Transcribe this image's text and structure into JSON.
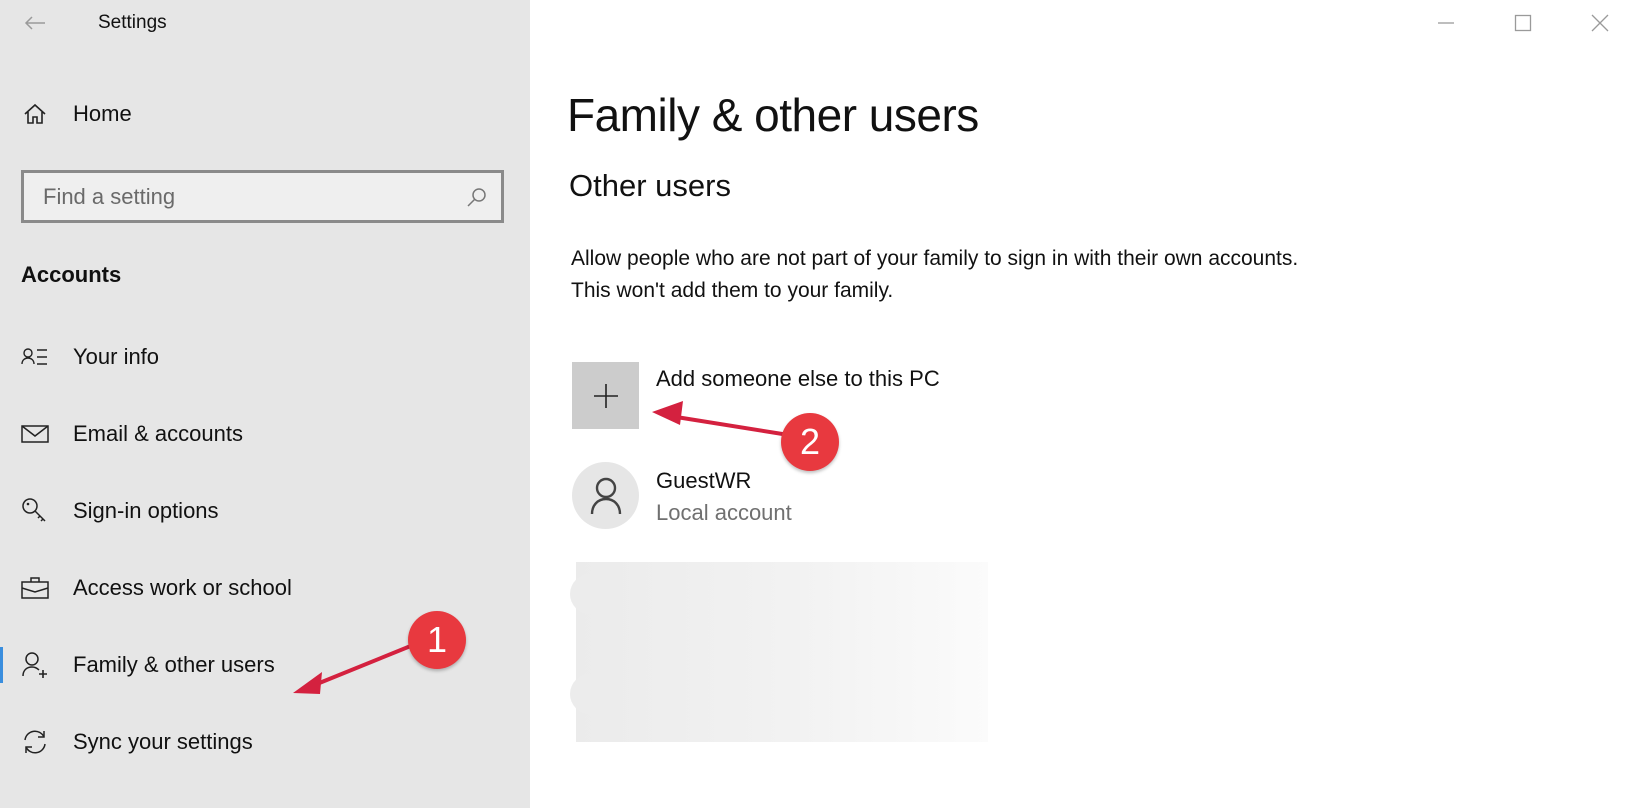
{
  "window": {
    "title": "Settings",
    "controls": {
      "minimize": "minimize-icon",
      "maximize": "maximize-icon",
      "close": "close-icon"
    }
  },
  "sidebar": {
    "home_label": "Home",
    "search": {
      "placeholder": "Find a setting",
      "value": ""
    },
    "section_label": "Accounts",
    "items": [
      {
        "label": "Your info",
        "icon": "contact-info-icon"
      },
      {
        "label": "Email & accounts",
        "icon": "mail-icon"
      },
      {
        "label": "Sign-in options",
        "icon": "key-icon"
      },
      {
        "label": "Access work or school",
        "icon": "briefcase-icon"
      },
      {
        "label": "Family & other users",
        "icon": "add-person-icon",
        "selected": true
      },
      {
        "label": "Sync your settings",
        "icon": "sync-icon"
      }
    ],
    "accent_color": "#3a8ede"
  },
  "main": {
    "title": "Family & other users",
    "section_title": "Other users",
    "description": "Allow people who are not part of your family to sign in with their own accounts. This won't add them to your family.",
    "add_user": {
      "label": "Add someone else to this PC",
      "icon": "plus-icon"
    },
    "users": [
      {
        "name": "GuestWR",
        "type": "Local account",
        "icon": "person-icon"
      }
    ]
  },
  "annotations": [
    {
      "number": "1",
      "target": "Family & other users"
    },
    {
      "number": "2",
      "target": "Add someone else to this PC"
    }
  ],
  "annotation_color": "#e8393f",
  "arrow_color": "#d4213f"
}
